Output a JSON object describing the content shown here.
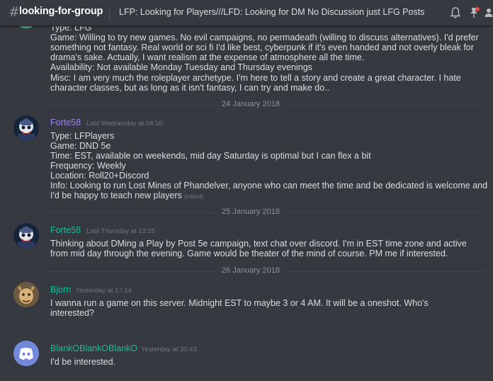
{
  "header": {
    "channel_name": "looking-for-group",
    "topic": "LFP: Looking for Players///LFD: Looking for DM No Discussion just LFG Posts",
    "icons": [
      "bell-icon",
      "pin-icon",
      "members-icon"
    ]
  },
  "colors": {
    "background": "#36393f",
    "text": "#dcddde",
    "username_purple": "#9b84ee",
    "username_teal": "#1abc9c",
    "timestamp": "#72767d"
  },
  "top_message": {
    "lines": [
      "Type: LFG",
      "Game: Willing to try new games. No evil campaigns, no permadeath (willing to discuss alternatives). I'd prefer",
      "something not fantasy. Real world or sci fi I'd like best, cyberpunk if it's even handed and not overly bleak for",
      "drama's sake. Actually, I want realism at the expense of atmosphere all the time.",
      "Availability: Not available Monday Tuesday and Thursday evenings",
      "Misc: I am very much the roleplayer archetype. I'm here to tell a story and create a great character. I hate",
      "character classes, but as long as it isn't fantasy, I can try and make do.."
    ]
  },
  "date_separators": [
    "24 January 2018",
    "25 January 2018",
    "26 January 2018"
  ],
  "messages": [
    {
      "username": "Forte58",
      "timestamp": "Last Wednesday at 04:10",
      "lines": [
        "Type: LFPlayers",
        "Game: DND 5e",
        "Time: EST, available on weekends, mid day Saturday is optimal but I can flex a bit",
        "Frequency: Weekly",
        "Location: Roll20+Discord",
        "Info: Looking to run Lost Mines of Phandelver, anyone who can meet the time and be dedicated is welcome and",
        "I'd be happy to teach new players"
      ],
      "edited": "(edited)"
    },
    {
      "username": "Forte58",
      "timestamp": "Last Thursday at 19:25",
      "lines": [
        "Thinking about DMing a Play by Post 5e campaign, text chat over discord. I'm in EST time zone and active",
        "from mid day through the evening. Game would be theater of the mind of course. PM me if interested."
      ]
    },
    {
      "username": "Bjorn",
      "timestamp": "Yesterday at 17:14",
      "lines": [
        "I wanna run a game on this server. Midnight EST to maybe 3 or 4 AM. It will be a oneshot. Who's",
        "interested?"
      ]
    },
    {
      "username": "BlankOBlankOBlankO",
      "timestamp": "Yesterday at 20:43",
      "lines": [
        "I'd be interested."
      ]
    }
  ]
}
